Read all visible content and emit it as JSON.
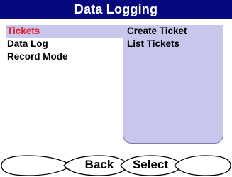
{
  "title": "Data Logging",
  "colors": {
    "title_bar": "#08087e",
    "selected_text": "#e0202c",
    "panel_fill": "#c7c7ee"
  },
  "left_menu": {
    "selected_index": 0,
    "items": [
      {
        "label": "Tickets"
      },
      {
        "label": "Data Log"
      },
      {
        "label": "Record Mode"
      }
    ]
  },
  "right_menu": {
    "items": [
      {
        "label": "Create Ticket"
      },
      {
        "label": "List Tickets"
      }
    ]
  },
  "softkeys": [
    {
      "label": ""
    },
    {
      "label": "Back"
    },
    {
      "label": "Select"
    },
    {
      "label": ""
    }
  ]
}
